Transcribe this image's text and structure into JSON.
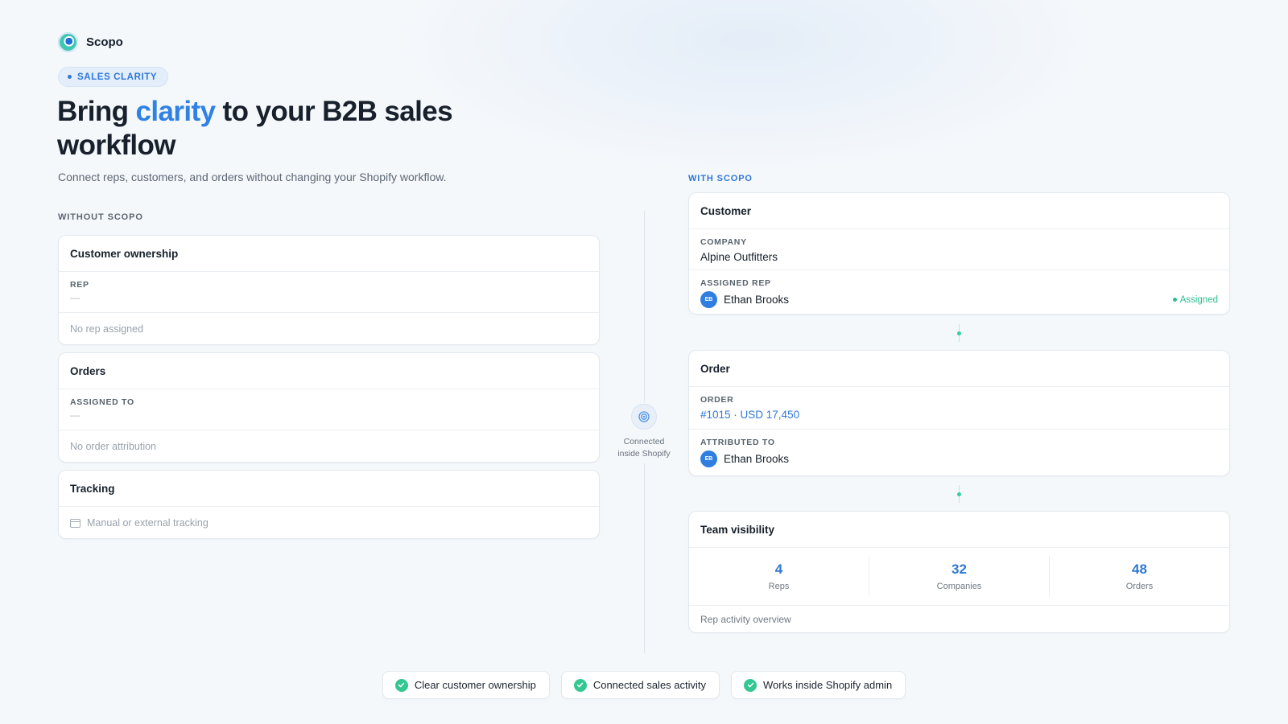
{
  "brand": {
    "name": "Scopo"
  },
  "hero": {
    "badge": "SALES CLARITY",
    "title_part1": "Bring ",
    "title_accent": "clarity",
    "title_part2": " to your B2B sales workflow",
    "subtitle": "Connect reps, customers, and orders without changing your Shopify workflow."
  },
  "colors": {
    "accent": "#2f82e3",
    "success": "#33c791",
    "text": "#17202b",
    "muted": "#9aa2ac"
  },
  "without": {
    "label": "WITHOUT SCOPO",
    "customer": {
      "title": "Customer ownership",
      "field_label": "REP",
      "field_value": "—",
      "note": "No rep assigned"
    },
    "orders": {
      "title": "Orders",
      "field_label": "ASSIGNED TO",
      "field_value": "—",
      "note": "No order attribution"
    },
    "tracking": {
      "title": "Tracking",
      "icon": "calendar-icon",
      "note": "Manual or external tracking"
    }
  },
  "connector": {
    "line1": "Connected",
    "line2": "inside Shopify",
    "icon": "target-icon"
  },
  "with": {
    "label": "WITH SCOPO",
    "customer": {
      "title": "Customer",
      "company_label": "COMPANY",
      "company_value": "Alpine Outfitters",
      "rep_label": "ASSIGNED REP",
      "rep_initials": "EB",
      "rep_name": "Ethan Brooks",
      "status": "Assigned"
    },
    "order": {
      "title": "Order",
      "order_label": "ORDER",
      "order_value": "#1015 · USD 17,450",
      "attr_label": "ATTRIBUTED TO",
      "rep_initials": "EB",
      "rep_name": "Ethan Brooks"
    },
    "team": {
      "title": "Team visibility",
      "stats": [
        {
          "value": "4",
          "label": "Reps"
        },
        {
          "value": "32",
          "label": "Companies"
        },
        {
          "value": "48",
          "label": "Orders"
        }
      ],
      "footer": "Rep activity overview"
    }
  },
  "benefits": [
    {
      "label": "Clear customer ownership",
      "icon": "check-circle-icon"
    },
    {
      "label": "Connected sales activity",
      "icon": "check-circle-icon"
    },
    {
      "label": "Works inside Shopify admin",
      "icon": "check-circle-icon"
    }
  ]
}
